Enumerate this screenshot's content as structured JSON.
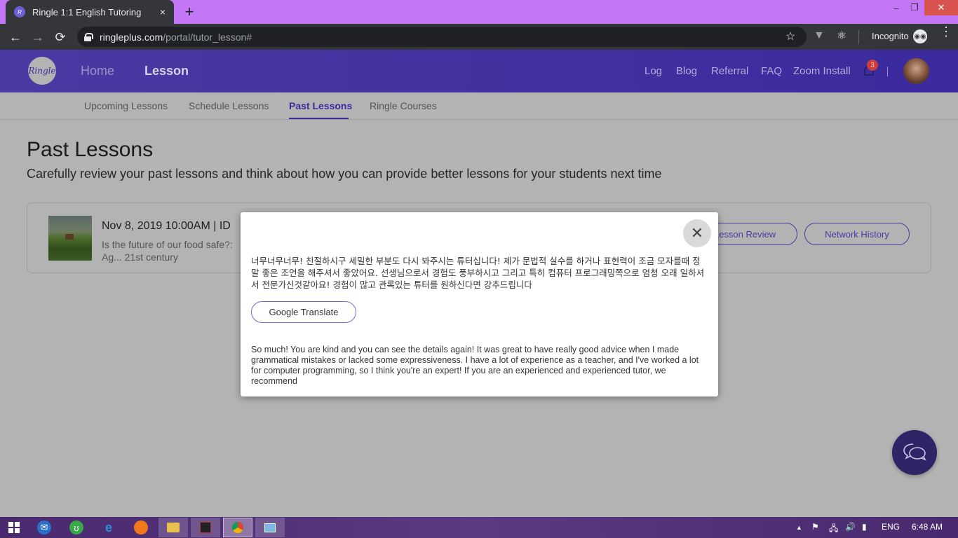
{
  "browser": {
    "tab_title": "Ringle 1:1 English Tutoring",
    "tab_close": "×",
    "new_tab": "+",
    "url_host": "ringleplus.com",
    "url_path": "/portal/tutor_lesson#",
    "incognito_label": "Incognito",
    "window_controls": {
      "minimize": "–",
      "restore": "❐",
      "close": "✕"
    },
    "nav": {
      "back": "←",
      "forward": "→",
      "reload": "⟳"
    },
    "bookmark_icon": "☆",
    "ext_v_icon": "▼",
    "ext_react_icon": "⚛",
    "menu_icon": "⋮"
  },
  "header": {
    "logo_text": "Ringle",
    "nav": {
      "home": "Home",
      "lesson": "Lesson"
    },
    "right_links": [
      "Log",
      "Blog",
      "Referral",
      "FAQ",
      "Zoom Install"
    ],
    "notification_count": "3",
    "divider": "|"
  },
  "subnav": {
    "tabs": [
      "Upcoming Lessons",
      "Schedule Lessons",
      "Past Lessons",
      "Ringle Courses"
    ],
    "active": "Past Lessons"
  },
  "page": {
    "title": "Past Lessons",
    "subtitle": "Carefully review your past lessons and think about how you can provide better lessons for your students next time"
  },
  "lesson": {
    "datetime": "Nov 8, 2019 10:00AM   |   ID",
    "topic": "Is the future of our food safe?: Ag... 21st century",
    "buttons": {
      "lesson_review": "Lesson Review",
      "network_history": "Network History"
    }
  },
  "modal": {
    "close_icon": "✕",
    "korean_text": "너무너무너무! 친절하시구 세밀한 부분도 다시 봐주시는 튜터십니다! 제가 문법적 실수를 하거나 표현력이 조금 모자를때 정말 좋은 조언을 해주셔서 좋았어요. 선생님으로서 경험도 풍부하시고 그리고 특히 컴퓨터 프로그래밍쪽으로 엄청 오래 일하셔서 전문가신것같아요! 경험이 많고 관록있는 튜터를 원하신다면 강추드립니다",
    "translate_button": "Google Translate",
    "english_text": "So much! You are kind and you can see the details again! It was great to have really good advice when I made grammatical mistakes or lacked some expressiveness. I have a lot of experience as a teacher, and I've worked a lot for computer programming, so I think you're an expert! If you are an experienced and experienced tutor, we recommend"
  },
  "taskbar": {
    "tray": {
      "language": "ENG",
      "time": "6:48 AM",
      "up_arrow": "▲"
    }
  },
  "colors": {
    "brand": "#3b2a9e",
    "titlebar": "#c377f6",
    "badge": "#cc3d3d",
    "fab": "#2e2566"
  }
}
